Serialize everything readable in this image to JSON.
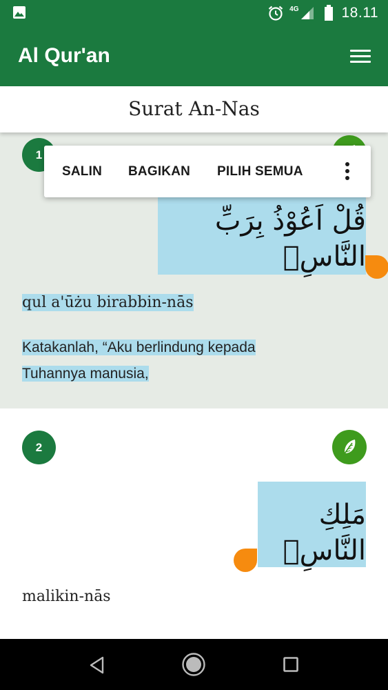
{
  "status_bar": {
    "time": "18.11",
    "network": "4G",
    "icons": [
      "image-notification-icon",
      "alarm-icon",
      "signal-icon",
      "battery-icon"
    ]
  },
  "app_bar": {
    "title": "Al Qur'an",
    "menu_icon": "hamburger-menu-icon"
  },
  "surah": {
    "title": "Surat An-Nas"
  },
  "selection_toolbar": {
    "copy": "SALIN",
    "share": "BAGIKAN",
    "select_all": "PILIH SEMUA",
    "more_icon": "more-vertical-icon"
  },
  "verses": [
    {
      "number": "1",
      "arabic": "قُلْ اَعُوْذُ بِرَبِّ النَّاسِۙ",
      "transliteration": "qul a'ūżu birabbin-nās",
      "translation_lines": [
        "Katakanlah, “Aku berlindung kepada",
        "Tuhannya manusia,"
      ]
    },
    {
      "number": "2",
      "arabic": "مَلِكِ النَّاسِۙ",
      "transliteration": "malikin-nās"
    }
  ],
  "colors": {
    "primary": "#1b7a3f",
    "leaf": "#3e9b1d",
    "selection": "#acdcec",
    "handle": "#f68b0f",
    "card_selected_bg": "#e6ebe5"
  },
  "nav_bar": {
    "icons": [
      "back-icon",
      "home-icon",
      "recents-icon"
    ]
  }
}
